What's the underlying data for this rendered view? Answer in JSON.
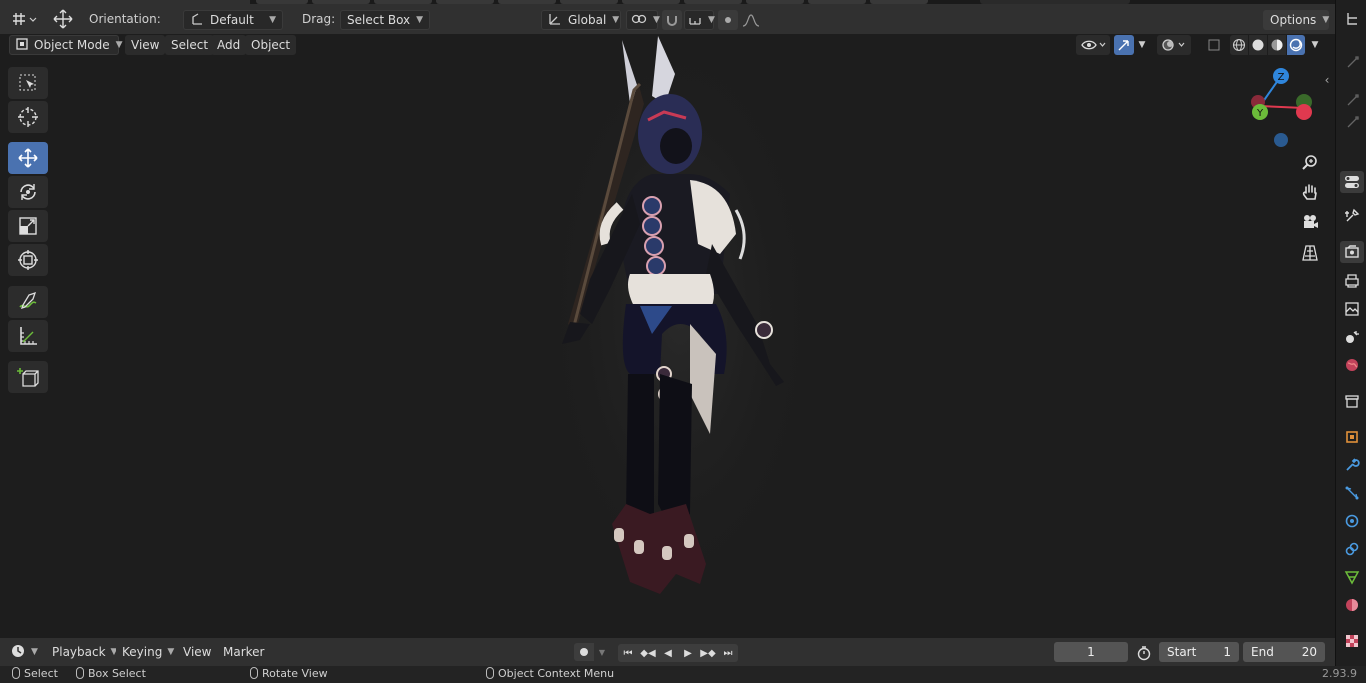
{
  "header": {
    "orientation_label": "Orientation:",
    "orientation_value": "Default",
    "drag_label": "Drag:",
    "drag_value": "Select Box",
    "transform_space": "Global",
    "options_label": "Options"
  },
  "viewport_header": {
    "mode": "Object Mode",
    "menus": [
      "View",
      "Select",
      "Add",
      "Object"
    ]
  },
  "gizmo": {
    "z_label": "Z",
    "y_label": "Y",
    "colors": {
      "x": "#e0394f",
      "y": "#6cbc3a",
      "z": "#2f86dc"
    }
  },
  "toolbar": {
    "tools": [
      "select-box",
      "cursor",
      "move",
      "rotate",
      "scale",
      "transform",
      "annotate",
      "measure",
      "add-cube"
    ],
    "active": "move"
  },
  "timeline": {
    "menus": [
      "Playback",
      "Keying",
      "View",
      "Marker"
    ],
    "current_frame": "1",
    "start_label": "Start",
    "start_value": "1",
    "end_label": "End",
    "end_value": "20"
  },
  "status": {
    "select": "Select",
    "box_select": "Box Select",
    "rotate_view": "Rotate View",
    "context_menu": "Object Context Menu",
    "version": "2.93.9"
  },
  "theme": {
    "accent": "#4a72b0",
    "background": "#1d1d1d"
  }
}
